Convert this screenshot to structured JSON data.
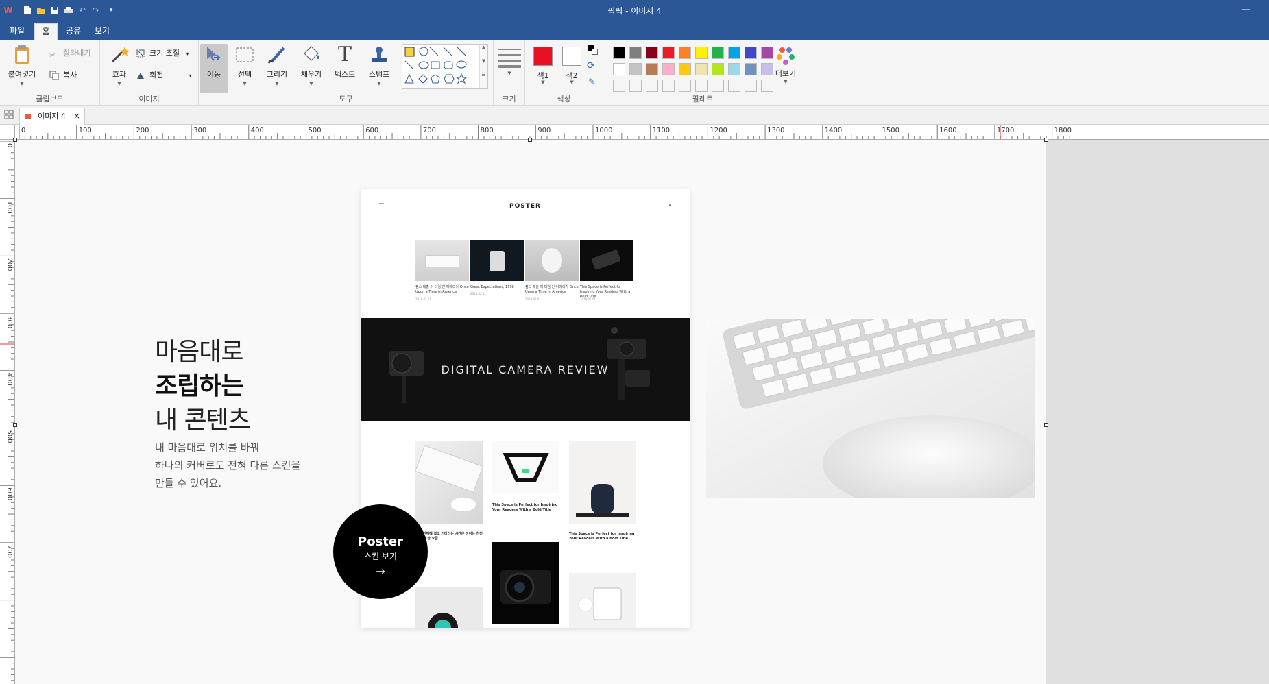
{
  "window": {
    "title": "픽픽 - 이미지 4"
  },
  "menu": {
    "tabs": [
      "파일",
      "홈",
      "공유",
      "보기"
    ]
  },
  "ribbon": {
    "clipboard": {
      "paste": "붙여넣기",
      "cut": "잘라내기",
      "copy": "복사",
      "label": "클립보드"
    },
    "image": {
      "effects": "효과",
      "resize": "크기 조절",
      "rotate": "회전",
      "label": "이미지"
    },
    "tools": {
      "move": "이동",
      "select": "선택",
      "draw": "그리기",
      "fill": "채우기",
      "text": "텍스트",
      "stamp": "스탬프",
      "label": "도구"
    },
    "size": {
      "label": "크기"
    },
    "color": {
      "color1": "색1",
      "color2": "색2",
      "label": "색상",
      "color1_value": "#e81123",
      "color2_value": "#ffffff"
    },
    "palette": {
      "more": "더보기",
      "label": "팔레트",
      "row1": [
        "#000000",
        "#7f7f7f",
        "#880015",
        "#ed1c24",
        "#ff7f27",
        "#fff200",
        "#22b14c",
        "#00a2e8",
        "#3f48cc",
        "#a349a4"
      ],
      "row2": [
        "#ffffff",
        "#c3c3c3",
        "#b97a57",
        "#ffaec9",
        "#ffc90e",
        "#efe4b0",
        "#b5e61d",
        "#99d9ea",
        "#7092be",
        "#c8bfe7"
      ]
    }
  },
  "document": {
    "tab_label": "이미지 4"
  },
  "ruler": {
    "h_labels": [
      "0",
      "100",
      "200",
      "300",
      "400",
      "500",
      "600",
      "700",
      "800",
      "900",
      "1000",
      "1100",
      "1200",
      "1300",
      "1400",
      "1500",
      "1600",
      "1700",
      "1800"
    ],
    "v_labels": [
      "0",
      "100",
      "200",
      "300",
      "400",
      "500",
      "600",
      "700"
    ]
  },
  "canvas": {
    "hero": {
      "line1": "마음대로",
      "line2": "조립하는",
      "line3": "내 콘텐츠",
      "desc1": "내 마음대로 위치를 바꿔",
      "desc2": "하나의 커버로도 전혀 다른 스킨을",
      "desc3": "만들 수 있어요."
    },
    "mockup": {
      "logo": "POSTER",
      "thumbs": [
        {
          "caption": "램스 매출 이 타임 인 아메리카 Once Upon a Time in America",
          "date": "2018.02.01"
        },
        {
          "caption": "Great Expectations, 1998",
          "date": "2018.02.01"
        },
        {
          "caption": "램스 매출 이 타임 인 아메리카 Once Upon a Time in America",
          "date": "2018.02.01"
        },
        {
          "caption": "This Space is Perfect for Inspiring Your Readers With a Bold Title",
          "date": "2018.02.01"
        }
      ],
      "banner_title": "DIGITAL CAMERA REVIEW",
      "grid_caption1": "This Space is Perfect for Inspiring Your Readers With a Bold Title",
      "grid_caption2": "This Space is Perfect for Inspiring Your Readers With a Bold Title",
      "grid_caption3": "한국 전체에 넓고 기다리는 시간은 아이는 천천에 따라 한 요금"
    },
    "poster_button": {
      "title": "Poster",
      "subtitle": "스킨 보기",
      "arrow": "→"
    }
  }
}
